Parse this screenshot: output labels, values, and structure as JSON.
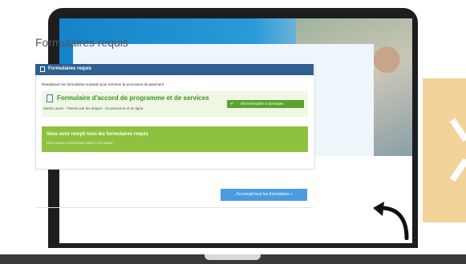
{
  "page": {
    "title": "Formulaires requis"
  },
  "panel": {
    "header": "Formulaires requis",
    "instructions": "Remplissez les formulaires suivants pour terminer le processus de paiement"
  },
  "form_item": {
    "title": "Formulaire d'accord de programme et de services",
    "subtitle": "Sarah Laurin - Passer par les étapes - en personne et en ligne",
    "button_label": "Afficher/Modifier le formulaire"
  },
  "success": {
    "title": "Vous avez rempli tous les formulaires requis",
    "subtitle": "Vous pouvez maintenant passer à la caisse"
  },
  "cta": {
    "label": "J'ai rempli tous les formulaires »"
  },
  "colors": {
    "accent": "#4c9be0",
    "success": "#8dc23f",
    "form_title": "#3f8f2b",
    "panel_header": "#2f5f8f",
    "deco": "#f2d39a"
  }
}
